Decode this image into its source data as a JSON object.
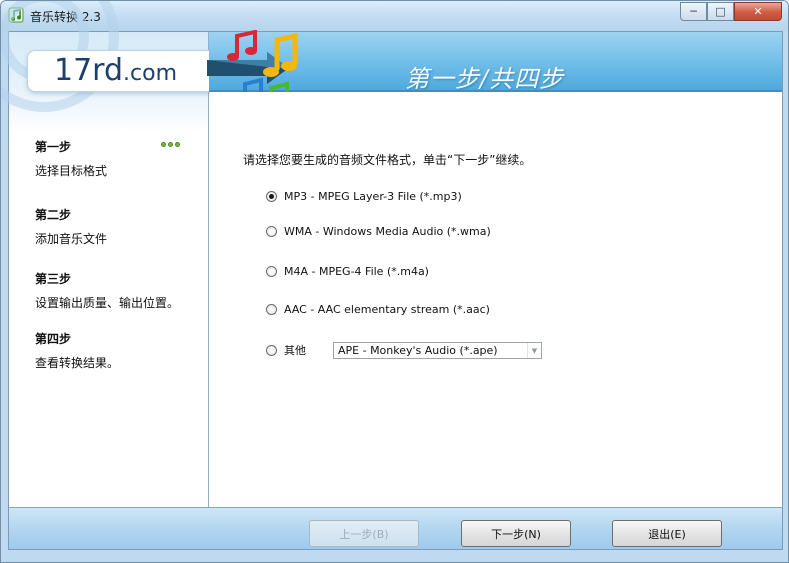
{
  "window": {
    "title": "音乐转换 2.3",
    "controls": {
      "minimize": "─",
      "maximize": "□",
      "close": "✕"
    }
  },
  "branding": {
    "logo_main": "17rd",
    "logo_suffix": ".com"
  },
  "banner": {
    "title": "第一步/共四步"
  },
  "sidebar": {
    "steps": [
      {
        "title": "第一步",
        "desc": "选择目标格式",
        "active": true
      },
      {
        "title": "第二步",
        "desc": "添加音乐文件"
      },
      {
        "title": "第三步",
        "desc": "设置输出质量、输出位置。"
      },
      {
        "title": "第四步",
        "desc": "查看转换结果。"
      }
    ]
  },
  "main": {
    "instruction": "请选择您要生成的音频文件格式，单击“下一步”继续。",
    "options": [
      {
        "label": "MP3 - MPEG Layer-3 File (*.mp3)",
        "checked": true
      },
      {
        "label": "WMA - Windows Media Audio (*.wma)",
        "checked": false
      },
      {
        "label": "M4A - MPEG-4 File (*.m4a)",
        "checked": false
      },
      {
        "label": "AAC - AAC elementary stream (*.aac)",
        "checked": false
      },
      {
        "label": "其他",
        "checked": false
      }
    ],
    "other_select": {
      "value": "APE - Monkey's Audio (*.ape)"
    }
  },
  "footer": {
    "prev_label": "上一步(B)",
    "next_label": "下一步(N)",
    "exit_label": "退出(E)"
  },
  "colors": {
    "banner": "#6fbde8",
    "footer": "#b3d6f0",
    "close_button": "#cf5a44",
    "active_step_dots": "#74b842"
  },
  "icons": [
    "app-icon",
    "music-notes-icon",
    "arrow-icon",
    "minimize-icon",
    "maximize-icon",
    "close-icon",
    "dropdown-arrow-icon"
  ]
}
